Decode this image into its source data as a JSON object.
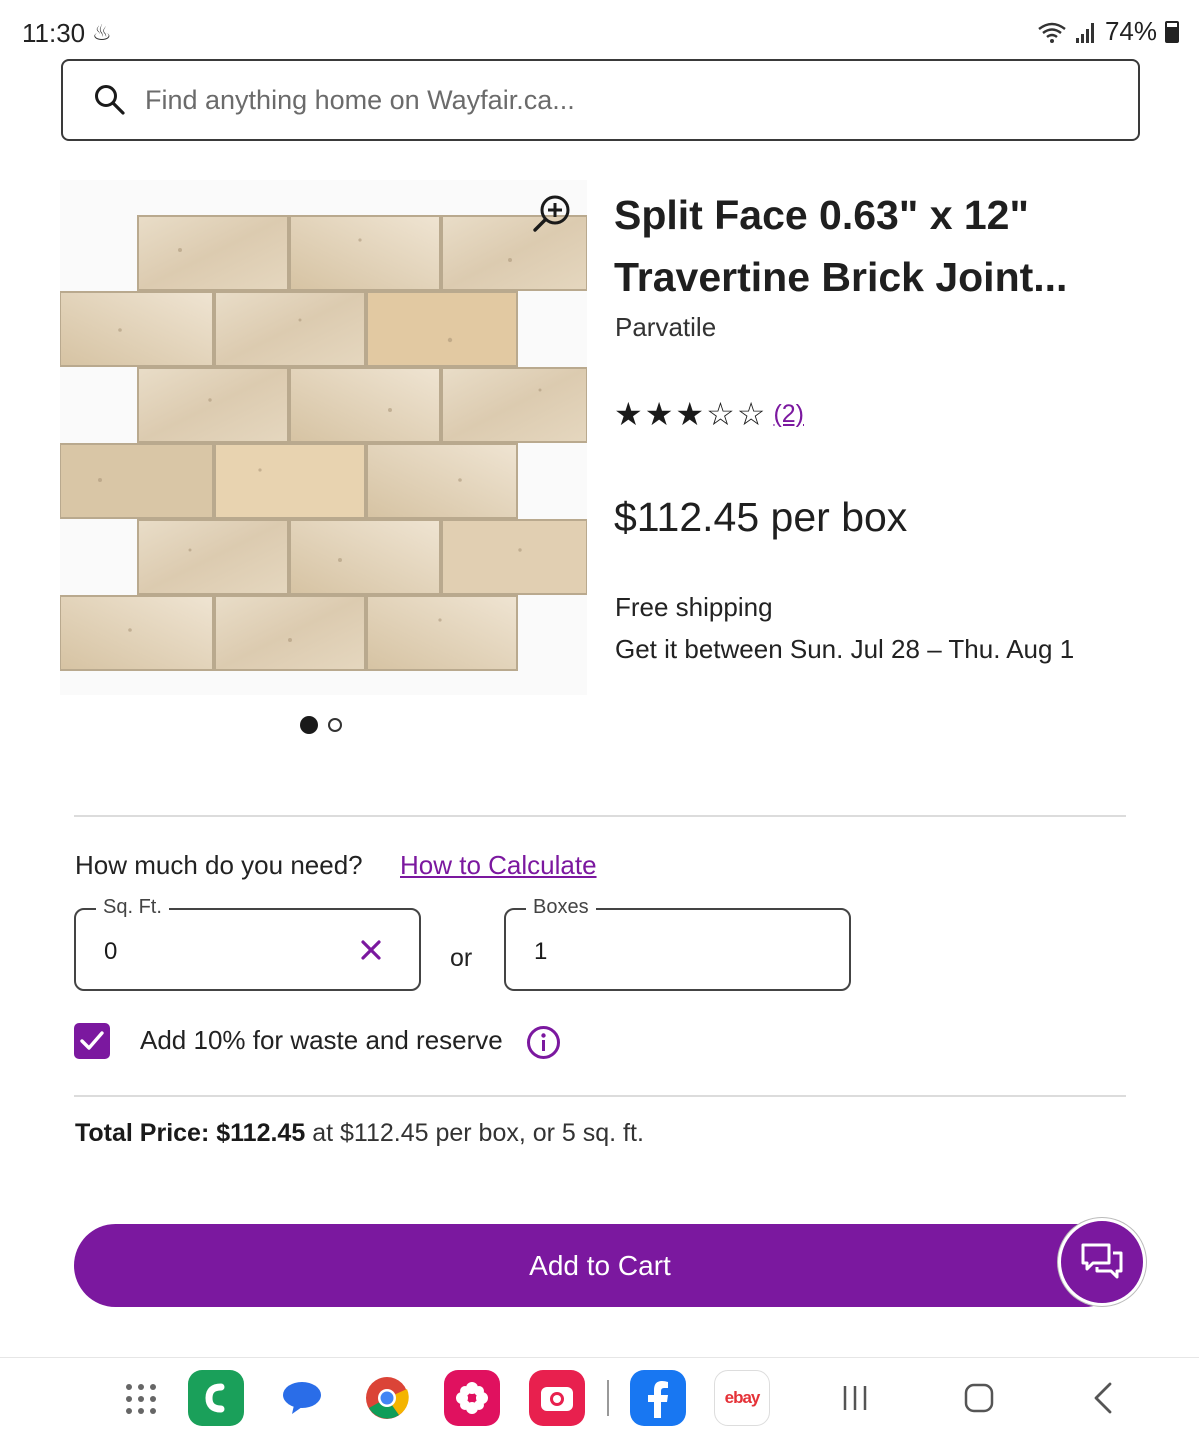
{
  "status_bar": {
    "time": "11:30",
    "battery": "74%"
  },
  "search": {
    "placeholder": "Find anything home on Wayfair.ca..."
  },
  "product": {
    "title": "Split Face 0.63\" x 12\" Travertine Brick Joint...",
    "brand": "Parvatile",
    "rating": 3,
    "rating_max": 5,
    "review_count": "(2)",
    "price": "$112.45 per box",
    "shipping": "Free shipping",
    "delivery": "Get it between Sun. Jul 28 – Thu. Aug 1",
    "image_count": 2,
    "active_image": 1
  },
  "quantity": {
    "question": "How much do you need?",
    "calc_link": "How to Calculate",
    "sqft_label": "Sq. Ft.",
    "sqft_value": "0",
    "or_text": "or",
    "boxes_label": "Boxes",
    "boxes_value": "1",
    "waste_label": "Add 10% for waste and reserve",
    "waste_checked": true
  },
  "total": {
    "label": "Total Price:",
    "amount": "$112.45",
    "detail": "at $112.45 per box, or 5 sq. ft."
  },
  "cart": {
    "button_label": "Add to Cart"
  },
  "colors": {
    "accent": "#7b189f",
    "text": "#1a1a1a"
  },
  "nav_bar": {
    "apps": [
      "apps-grid-icon",
      "phone-app-icon",
      "messages-app-icon",
      "chrome-app-icon",
      "flower-app-icon",
      "camera-app-icon",
      "facebook-app-icon",
      "ebay-app-icon"
    ],
    "ebay_label": "ebay"
  }
}
